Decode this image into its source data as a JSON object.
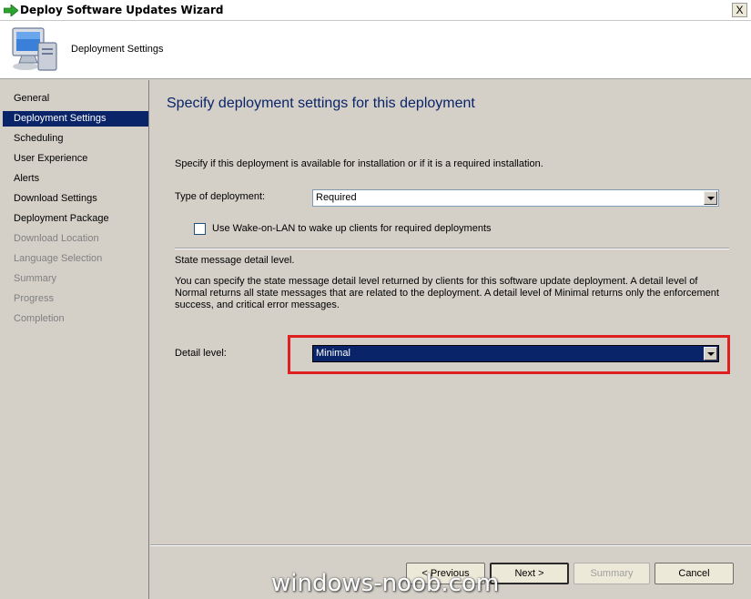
{
  "window": {
    "title": "Deploy Software Updates Wizard",
    "close_label": "X"
  },
  "header": {
    "title": "Deployment Settings",
    "icon": "computer-monitor-icon"
  },
  "sidebar": {
    "items": [
      {
        "label": "General",
        "state": "normal"
      },
      {
        "label": "Deployment Settings",
        "state": "active"
      },
      {
        "label": "Scheduling",
        "state": "normal"
      },
      {
        "label": "User Experience",
        "state": "normal"
      },
      {
        "label": "Alerts",
        "state": "normal"
      },
      {
        "label": "Download Settings",
        "state": "normal"
      },
      {
        "label": "Deployment Package",
        "state": "normal"
      },
      {
        "label": "Download Location",
        "state": "disabled"
      },
      {
        "label": "Language Selection",
        "state": "disabled"
      },
      {
        "label": "Summary",
        "state": "disabled"
      },
      {
        "label": "Progress",
        "state": "disabled"
      },
      {
        "label": "Completion",
        "state": "disabled"
      }
    ]
  },
  "main": {
    "heading": "Specify deployment settings for this deployment",
    "intro": "Specify if this deployment is available for installation or if it  is a required installation.",
    "deployment_type": {
      "label": "Type of deployment:",
      "value": "Required"
    },
    "wake_on_lan": {
      "label": "Use Wake-on-LAN to wake up clients for required deployments",
      "checked": false
    },
    "state_message": {
      "title": "State message detail level.",
      "description": "You can specify the state message detail level returned by clients for this software update deployment.  A detail level of Normal returns all state messages that are related to the deployment.  A detail level of Minimal returns only the enforcement success, and critical error messages."
    },
    "detail_level": {
      "label": "Detail level:",
      "value": "Minimal"
    }
  },
  "buttons": {
    "previous": "< Previous",
    "next": "Next >",
    "summary": "Summary",
    "cancel": "Cancel"
  },
  "watermark": "windows-noob.com",
  "colors": {
    "accent": "#0a246a",
    "highlight": "#e02020",
    "background": "#d4d0c8"
  }
}
